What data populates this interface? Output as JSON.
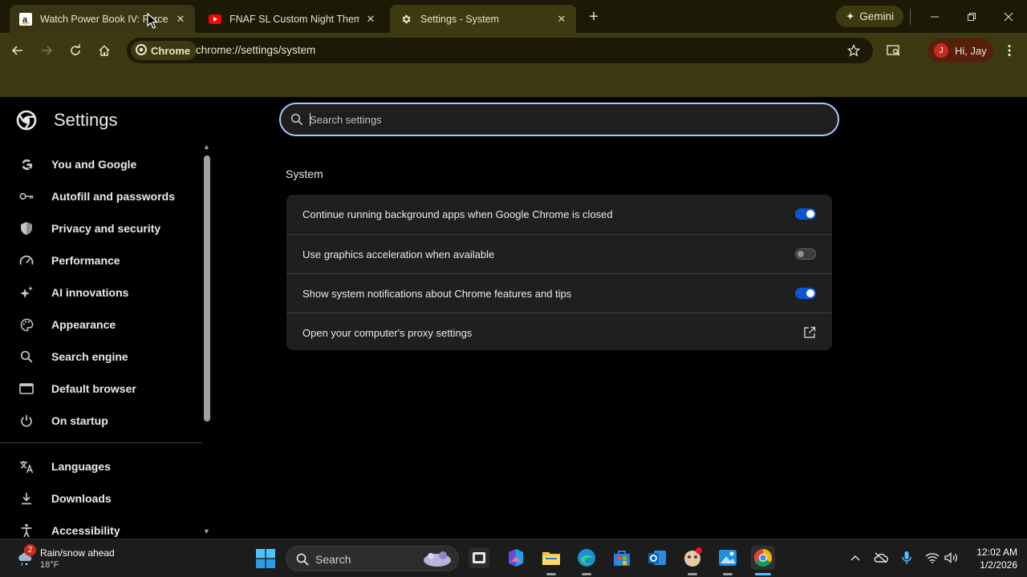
{
  "browser": {
    "tabs": [
      {
        "title": "Watch Power Book IV: Force Se",
        "favicon": "amazon-icon",
        "state": "hover"
      },
      {
        "title": "FNAF SL Custom Night Theme",
        "favicon": "youtube-icon",
        "state": "normal"
      },
      {
        "title": "Settings - System",
        "favicon": "gear-icon",
        "state": "active"
      }
    ],
    "gemini_label": "Gemini",
    "chip_label": "Chrome",
    "url": "chrome://settings/system",
    "profile_initial": "J",
    "profile_label": "Hi, Jay",
    "theme_color": "#3d3a12"
  },
  "settings": {
    "title": "Settings",
    "search_placeholder": "Search settings",
    "nav": [
      {
        "label": "You and Google",
        "icon": "google-icon"
      },
      {
        "label": "Autofill and passwords",
        "icon": "key-icon"
      },
      {
        "label": "Privacy and security",
        "icon": "shield-icon"
      },
      {
        "label": "Performance",
        "icon": "speedometer-icon"
      },
      {
        "label": "AI innovations",
        "icon": "sparkle-icon"
      },
      {
        "label": "Appearance",
        "icon": "palette-icon"
      },
      {
        "label": "Search engine",
        "icon": "search-icon"
      },
      {
        "label": "Default browser",
        "icon": "browser-window-icon"
      },
      {
        "label": "On startup",
        "icon": "power-icon"
      },
      {
        "label": "Languages",
        "icon": "translate-icon"
      },
      {
        "label": "Downloads",
        "icon": "download-icon"
      },
      {
        "label": "Accessibility",
        "icon": "accessibility-icon"
      }
    ],
    "section_title": "System",
    "rows": [
      {
        "label": "Continue running background apps when Google Chrome is closed",
        "control": "toggle",
        "enabled": true
      },
      {
        "label": "Use graphics acceleration when available",
        "control": "toggle",
        "enabled": false
      },
      {
        "label": "Show system notifications about Chrome features and tips",
        "control": "toggle",
        "enabled": true
      },
      {
        "label": "Open your computer's proxy settings",
        "control": "external-link-icon"
      }
    ],
    "accent_color": "#0b57d0"
  },
  "taskbar": {
    "weather_text": "Rain/snow ahead",
    "weather_temp": "18°F",
    "weather_badge": "2",
    "search_label": "Search",
    "time": "12:02 AM",
    "date": "1/2/2026"
  }
}
